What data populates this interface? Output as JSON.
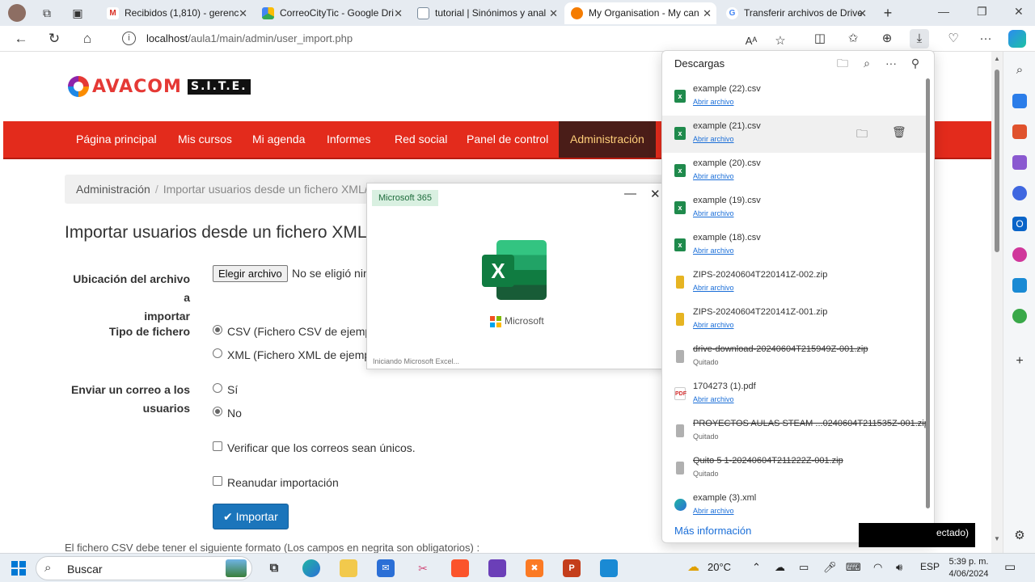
{
  "browser": {
    "tabs": [
      {
        "label": "Recibidos (1,810) - gerenc",
        "icon": "gmail-icon"
      },
      {
        "label": "CorreoCityTic - Google Dri",
        "icon": "google-drive-icon"
      },
      {
        "label": "tutorial | Sinónimos y anal",
        "icon": "document-icon"
      },
      {
        "label": "My Organisation - My can",
        "icon": "moodle-icon"
      },
      {
        "label": "Transferir archivos de Drive",
        "icon": "google-icon"
      }
    ],
    "url_host": "localhost",
    "url_path": "/aula1/main/admin/user_import.php"
  },
  "site": {
    "logo_text": "AVACOM",
    "logo_badge": "S.I.T.E.",
    "nav": [
      "Página principal",
      "Mis cursos",
      "Mi agenda",
      "Informes",
      "Red social",
      "Panel de control",
      "Administración"
    ],
    "breadcrumb": {
      "root": "Administración",
      "separator": "/",
      "current": "Importar usuarios desde un fichero XML/"
    },
    "page_title": "Importar usuarios desde un fichero XML/",
    "form": {
      "file_label": "Ubicación del archivo a importar",
      "file_label_l1": "Ubicación del archivo a",
      "file_label_l2": "importar",
      "file_button": "Elegir archivo",
      "file_status": "No se eligió nin",
      "type_label": "Tipo de fichero",
      "type_csv": "CSV (Fichero CSV de ejemplo",
      "type_xml": "XML (Fichero XML de ejempl",
      "email_label_l1": "Enviar un correo a los",
      "email_label_l2": "usuarios",
      "email_yes": "Sí",
      "email_no": "No",
      "check_unique": "Verificar que los correos sean únicos.",
      "check_resume": "Reanudar importación",
      "import_button": "Importar",
      "footer": "El fichero CSV debe tener el siguiente formato (Los campos en negrita son obligatorios) :"
    }
  },
  "excel_splash": {
    "badge": "Microsoft 365",
    "brand": "Microsoft",
    "status": "Iniciando Microsoft Excel..."
  },
  "downloads": {
    "title": "Descargas",
    "more": "Más información",
    "items": [
      {
        "name": "example (22).csv",
        "sub": "Abrir archivo",
        "type": "excel",
        "removed": false
      },
      {
        "name": "example (21).csv",
        "sub": "Abrir archivo",
        "type": "excel",
        "removed": false
      },
      {
        "name": "example (20).csv",
        "sub": "Abrir archivo",
        "type": "excel",
        "removed": false
      },
      {
        "name": "example (19).csv",
        "sub": "Abrir archivo",
        "type": "excel",
        "removed": false
      },
      {
        "name": "example (18).csv",
        "sub": "Abrir archivo",
        "type": "excel",
        "removed": false
      },
      {
        "name": "ZIPS-20240604T220141Z-002.zip",
        "sub": "Abrir archivo",
        "type": "zip",
        "removed": false
      },
      {
        "name": "ZIPS-20240604T220141Z-001.zip",
        "sub": "Abrir archivo",
        "type": "zip",
        "removed": false
      },
      {
        "name": "drive-download-20240604T215949Z-001.zip",
        "sub": "Quitado",
        "type": "zip",
        "removed": true
      },
      {
        "name": "1704273 (1).pdf",
        "sub": "Abrir archivo",
        "type": "pdf",
        "removed": false
      },
      {
        "name": "PROYECTOS AULAS STEAM ...0240604T211535Z-001.zip",
        "sub": "Quitado",
        "type": "zip",
        "removed": true
      },
      {
        "name": "Quito 5 1-20240604T211222Z-001.zip",
        "sub": "Quitado",
        "type": "zip",
        "removed": true
      },
      {
        "name": "example (3).xml",
        "sub": "Abrir archivo",
        "type": "edge",
        "removed": false
      }
    ],
    "overlay_text": "ectado)"
  },
  "taskbar": {
    "search_placeholder": "Buscar",
    "temperature": "20°C",
    "language": "ESP",
    "time": "5:39 p. m.",
    "date": "4/06/2024"
  },
  "colors": {
    "nav_red": "#e32b1c",
    "nav_active": "#4a1d18",
    "primary_button": "#1b75bb",
    "excel_green": "#107c41"
  }
}
